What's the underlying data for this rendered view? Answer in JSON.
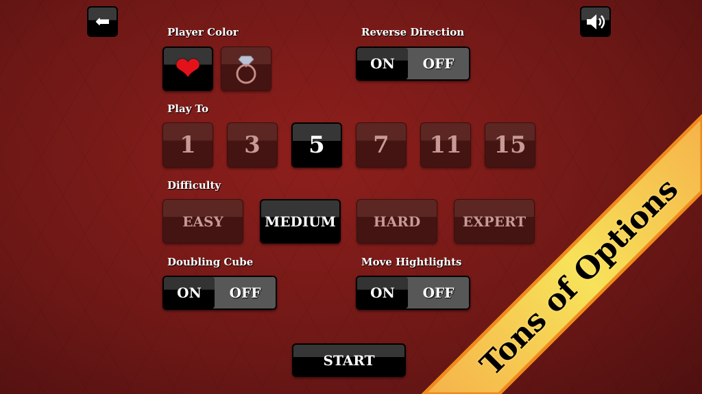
{
  "header": {
    "back_icon": "arrow-left-icon",
    "sound_icon": "speaker-icon"
  },
  "player_color": {
    "label": "Player Color",
    "options": [
      {
        "icon": "heart-icon",
        "selected": true
      },
      {
        "icon": "ring-icon",
        "selected": false
      }
    ]
  },
  "reverse_direction": {
    "label": "Reverse Direction",
    "on": "ON",
    "off": "OFF",
    "value": "ON"
  },
  "play_to": {
    "label": "Play To",
    "options": [
      "1",
      "3",
      "5",
      "7",
      "11",
      "15"
    ],
    "selected": "5"
  },
  "difficulty": {
    "label": "Difficulty",
    "options": [
      "EASY",
      "MEDIUM",
      "HARD",
      "EXPERT"
    ],
    "selected": "MEDIUM"
  },
  "doubling_cube": {
    "label": "Doubling Cube",
    "on": "ON",
    "off": "OFF",
    "value": "ON"
  },
  "move_highlights": {
    "label": "Move Hightlights",
    "on": "ON",
    "off": "OFF",
    "value": "ON"
  },
  "start_label": "START",
  "banner": {
    "text": "Tons of Options",
    "colors": {
      "fill": "#f7c94e",
      "edge": "#f08a1c"
    }
  }
}
